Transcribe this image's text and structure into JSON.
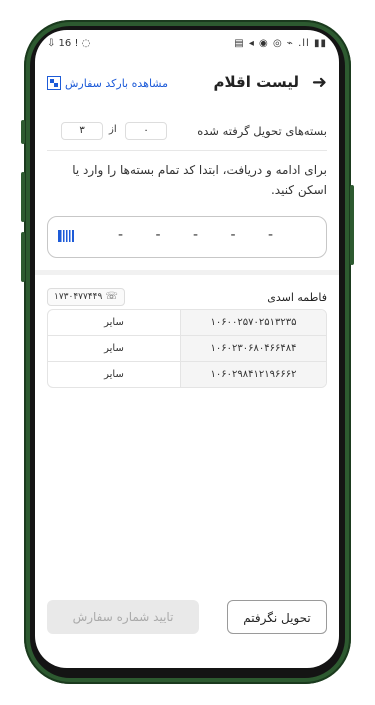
{
  "status_bar": {
    "left": "‪⇩ 16 ! ◌‬",
    "right": "▤ ◂ ◉ ◎ ⌁ .ll ▮▮"
  },
  "header": {
    "title": "لیست اقلام",
    "barcode_link": "مشاهده بارکد سفارش"
  },
  "counter": {
    "label": "بسته‌های تحویل گرفته شده",
    "received": "۰",
    "of": "از",
    "total": "۳"
  },
  "instructions": "برای ادامه و دریافت، ابتدا کد تمام بسته‌ها را وارد یا اسکن کنید.",
  "scan_input": {
    "value": "- - - - -"
  },
  "customer": {
    "name": "فاطمه اسدی",
    "phone": "۱۷۳۰۴۷۷۴۴۹"
  },
  "items": [
    {
      "code": "۱۰۶۰۰۲۵۷۰۲۵۱۳۲۳۵",
      "type": "سایر"
    },
    {
      "code": "۱۰۶۰۲۳۰۶۸۰۴۶۶۴۸۴",
      "type": "سایر"
    },
    {
      "code": "۱۰۶۰۲۹۸۴۱۲۱۹۶۶۶۲",
      "type": "سایر"
    }
  ],
  "footer": {
    "not_received": "تحویل نگرفتم",
    "confirm": "تایید شماره سفارش"
  },
  "colors": {
    "accent": "#1d5bd8",
    "phone_frame": "#2d5a30"
  }
}
